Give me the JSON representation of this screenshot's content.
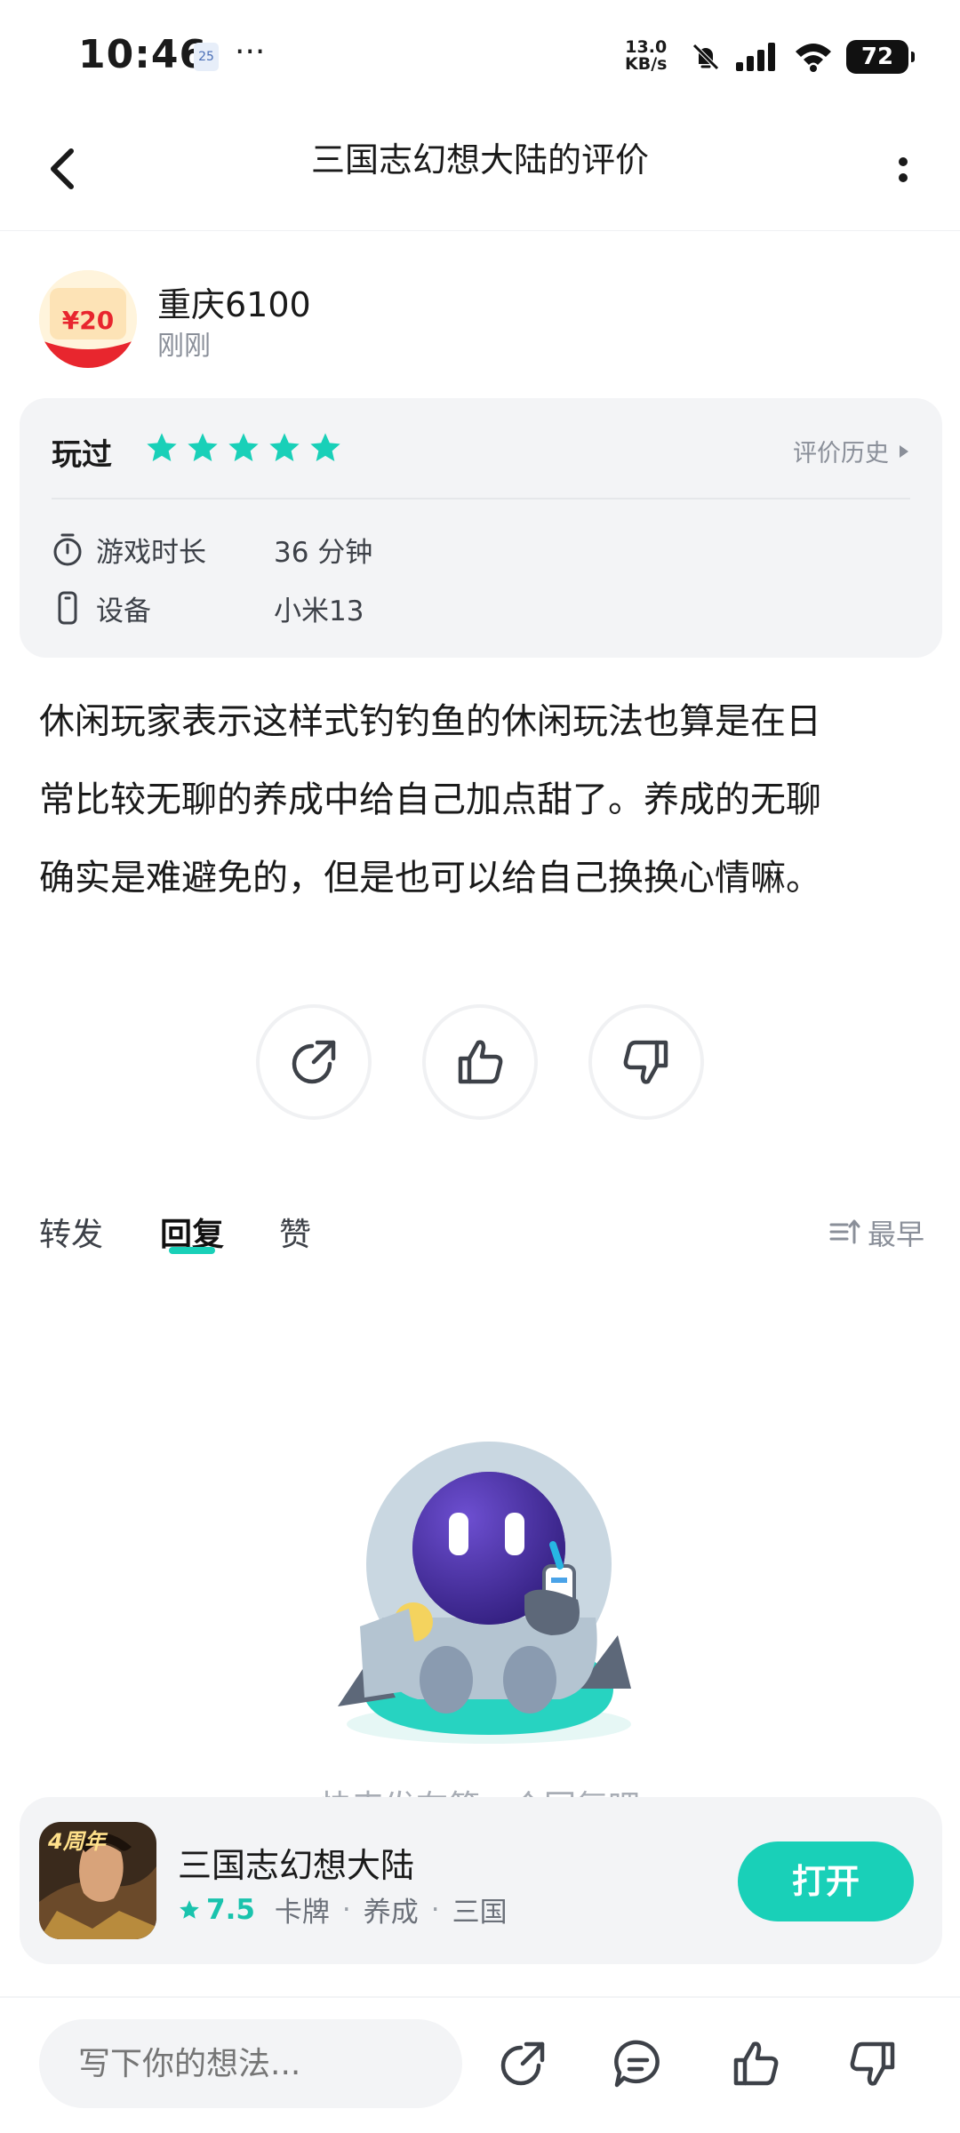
{
  "status_bar": {
    "time": "10:46",
    "calendar_day": "25",
    "more": "···",
    "net_speed_value": "13.0",
    "net_speed_unit": "KB/s",
    "battery": "72"
  },
  "header": {
    "title": "三国志幻想大陆的评价"
  },
  "author": {
    "name": "重庆6100",
    "time": "刚刚",
    "avatar_text": "¥20"
  },
  "rating": {
    "played_label": "玩过",
    "stars": 5,
    "history_label": "评价历史",
    "rows": [
      {
        "icon": "timer-icon",
        "label": "游戏时长",
        "value": "36 分钟"
      },
      {
        "icon": "phone-icon",
        "label": "设备",
        "value": "小米13"
      }
    ]
  },
  "review": {
    "lines": [
      "休闲玩家表示这样式钓钓鱼的休闲玩法也算是在日",
      "常比较无聊的养成中给自己加点甜了。养成的无聊",
      "确实是难避免的，但是也可以给自己换换心情嘛。"
    ]
  },
  "tabs": {
    "items": [
      "转发",
      "回复",
      "赞"
    ],
    "active": "回复",
    "sort_label": "最早"
  },
  "empty_state": {
    "text": "快来发布第一个回复吧"
  },
  "game": {
    "name": "三国志幻想大陆",
    "score": "7.5",
    "tags": [
      "卡牌",
      "养成",
      "三国"
    ],
    "open_label": "打开",
    "badge": "4周年"
  },
  "bottom_bar": {
    "input_placeholder": "写下你的想法..."
  },
  "colors": {
    "accent": "#19d0b8",
    "card_bg": "#f3f4f6",
    "muted_text": "#8a8f99"
  }
}
